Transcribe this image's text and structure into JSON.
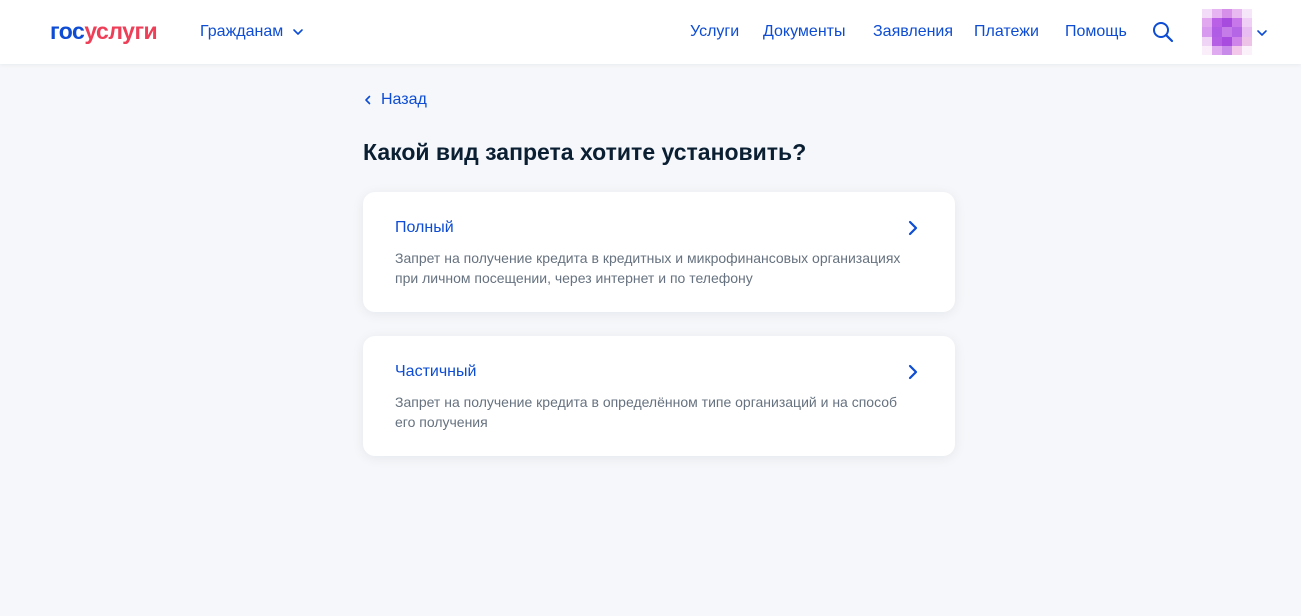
{
  "header": {
    "logo": {
      "part1": "гос",
      "part2": "услуги"
    },
    "audience_label": "Гражданам",
    "nav": [
      {
        "label": "Услуги"
      },
      {
        "label": "Документы"
      },
      {
        "label": "Заявления"
      },
      {
        "label": "Платежи"
      },
      {
        "label": "Помощь"
      }
    ],
    "search_icon": "search-icon",
    "avatar": "blurred-avatar"
  },
  "main": {
    "back_label": "Назад",
    "title": "Какой вид запрета хотите установить?",
    "options": [
      {
        "title": "Полный",
        "description": "Запрет на получение кредита в кредитных и микрофинансовых организациях при личном посещении, через интернет и по телефону"
      },
      {
        "title": "Частичный",
        "description": "Запрет на получение кредита в определённом типе организаций и на способ его получения"
      }
    ]
  },
  "colors": {
    "brand_blue": "#0d4cd3",
    "brand_red": "#ee3f58",
    "text_primary": "#0b1f33",
    "text_secondary": "#66727f",
    "background": "#f5f7fa",
    "card": "#ffffff"
  }
}
